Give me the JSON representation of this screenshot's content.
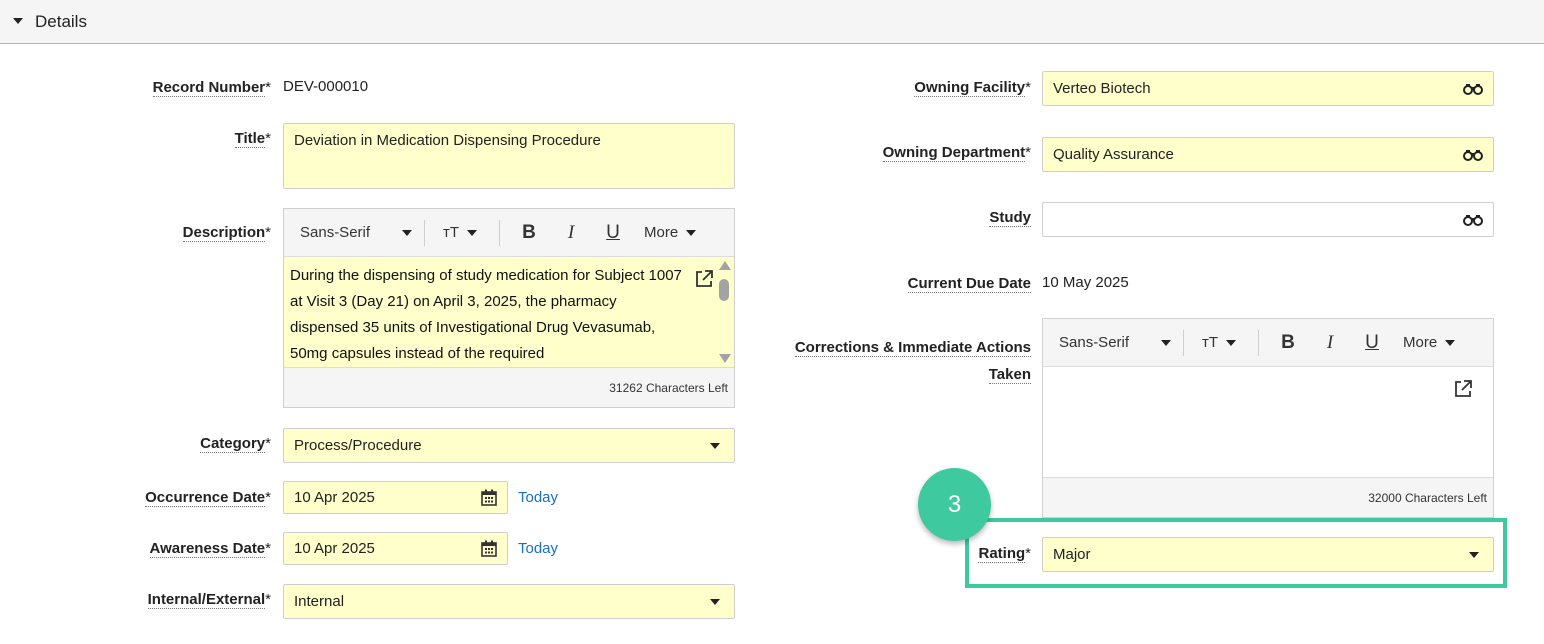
{
  "section": {
    "title": "Details"
  },
  "left": {
    "record_number": {
      "label": "Record Number",
      "required": "*",
      "value": "DEV-000010"
    },
    "title": {
      "label": "Title",
      "required": "*",
      "value": "Deviation in Medication Dispensing Procedure"
    },
    "description": {
      "label": "Description",
      "required": "*",
      "font": "Sans-Serif",
      "more": "More",
      "text": "During the dispensing of study medication for Subject 1007 at Visit 3 (Day 21) on April 3, 2025, the pharmacy dispensed 35 units of Investigational Drug Vevasumab, 50mg capsules instead of the required",
      "chars_left": "31262 Characters Left"
    },
    "category": {
      "label": "Category",
      "required": "*",
      "value": "Process/Procedure"
    },
    "occurrence_date": {
      "label": "Occurrence Date",
      "required": "*",
      "value": "10 Apr 2025",
      "today": "Today"
    },
    "awareness_date": {
      "label": "Awareness Date",
      "required": "*",
      "value": "10 Apr 2025",
      "today": "Today"
    },
    "internal_external": {
      "label": "Internal/External",
      "required": "*",
      "value": "Internal"
    }
  },
  "right": {
    "owning_facility": {
      "label": "Owning Facility",
      "required": "*",
      "value": "Verteo Biotech"
    },
    "owning_department": {
      "label": "Owning Department",
      "required": "*",
      "value": "Quality Assurance"
    },
    "study": {
      "label": "Study",
      "value": ""
    },
    "current_due_date": {
      "label": "Current Due Date",
      "value": "10 May 2025"
    },
    "corrections": {
      "label_line1": "Corrections & Immediate Actions",
      "label_line2": "Taken",
      "font": "Sans-Serif",
      "more": "More",
      "text": "",
      "chars_left": "32000 Characters Left"
    },
    "rating": {
      "label": "Rating",
      "required": "*",
      "value": "Major"
    }
  },
  "toolbar_glyphs": {
    "size": "тT",
    "bold": "B",
    "italic": "I",
    "underline": "U"
  },
  "step_badge": "3",
  "colors": {
    "required_fill": "#ffffcc",
    "accent": "#3fc99f",
    "link": "#1a6fc0",
    "header_border": "#f0a64a"
  },
  "icons": [
    "caret-down-icon",
    "binoculars-icon",
    "calendar-icon",
    "popout-icon"
  ]
}
